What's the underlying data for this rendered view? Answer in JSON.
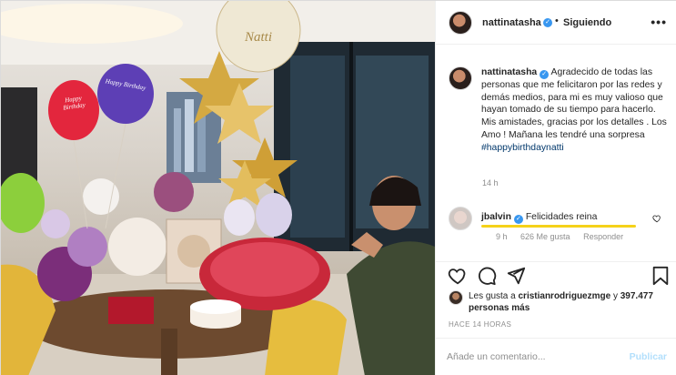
{
  "post": {
    "author": {
      "username": "nattinatasha",
      "follow_status": "Siguiendo",
      "separator": "•"
    },
    "caption": {
      "username": "nattinatasha",
      "text": "Agradecido de todas las personas que me felicitaron por las redes y demás medios, para mi es muy valioso que hayan tomado de su tiempo para hacerlo. Mis amistades, gracias por los detalles . Los Amo ! Mañana les tendré una sorpresa ",
      "hashtag": "#happybirthdaynatti",
      "time": "14 h"
    },
    "reply": {
      "username": "jbalvin",
      "text": "Felicidades reina",
      "time": "9 h",
      "likes": "626 Me gusta",
      "reply_label": "Responder"
    },
    "likes": {
      "prefix": "Les gusta a ",
      "user": "cristianrodriguezmge",
      "middle": " y",
      "count": "397.477 personas más"
    },
    "time_ago": "HACE 14 HORAS",
    "comment_box": {
      "placeholder": "Añade un comentario...",
      "submit_label": "Publicar"
    },
    "photo": {
      "balloon_text_1": "Happy Birthday",
      "balloon_text_2": "Happy Birthday",
      "balloon_text_top": "Natti"
    }
  },
  "icons": {
    "verified": "verified-badge-icon",
    "more": "more-options-icon",
    "heart": "heart-icon",
    "comment": "comment-icon",
    "share": "share-icon",
    "save": "bookmark-icon"
  },
  "colors": {
    "verified": "#3897f0",
    "link": "#00376b",
    "muted": "#8e8e8e",
    "publish": "#b2dffc",
    "highlight": "#f5d21a"
  }
}
